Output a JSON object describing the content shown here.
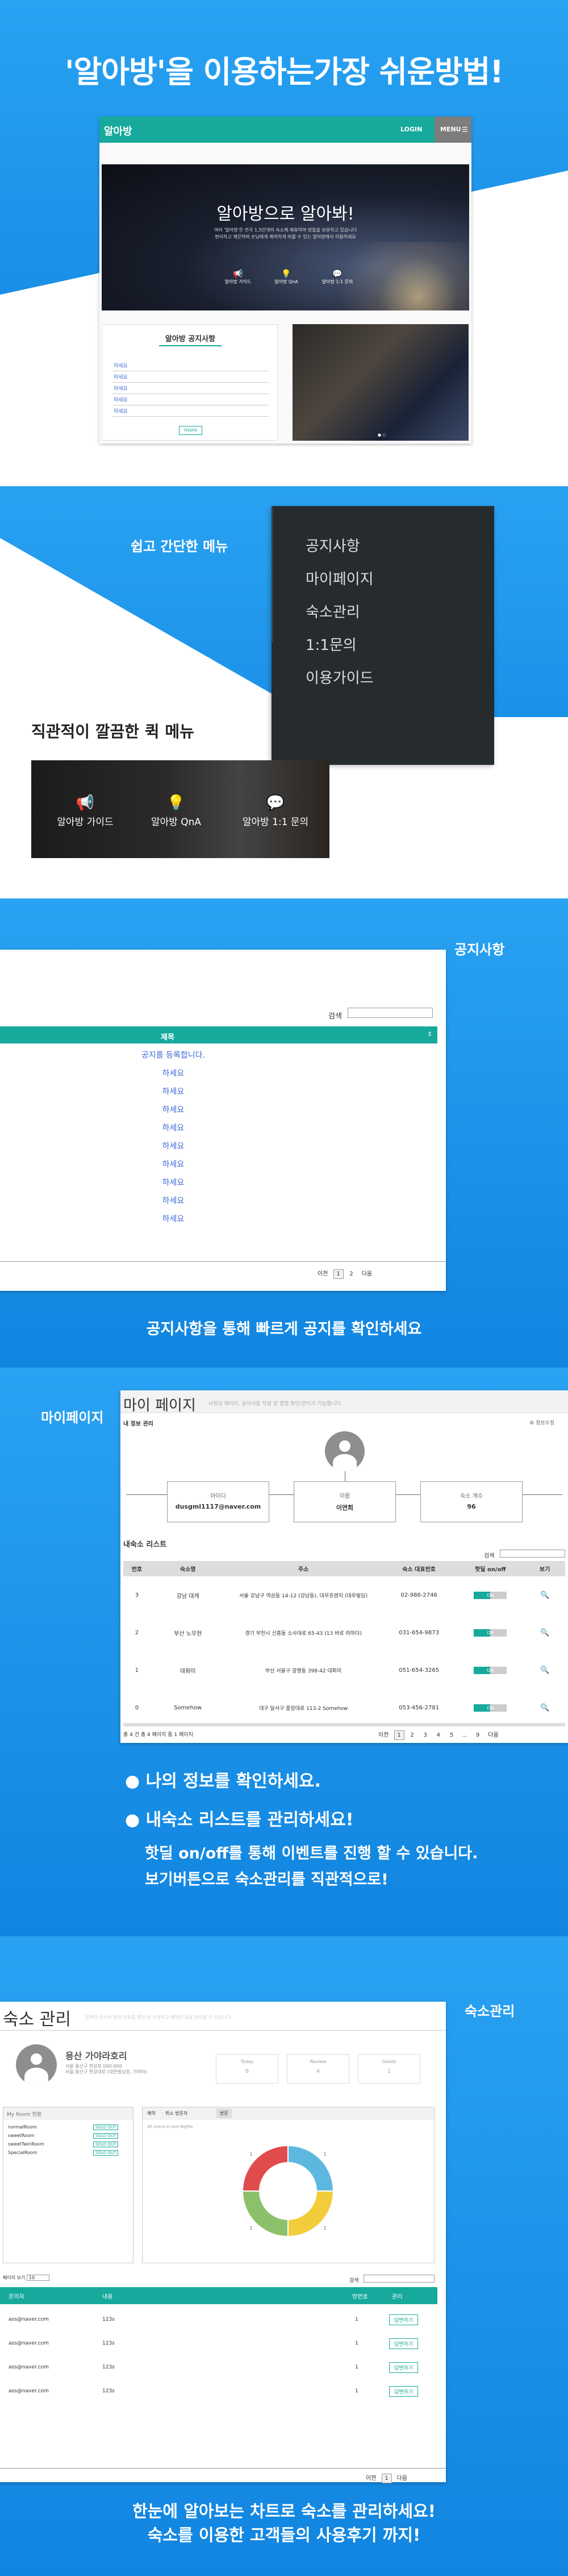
{
  "section1": {
    "headline": "'알아방'을 이용하는가장 쉬운방법!",
    "mock": {
      "logo": "알아방",
      "login": "LOGIN",
      "menu": "MENU",
      "hero_title": "알아방으로 알아봐!",
      "hero_sub1": "여러 '알아방'은 전국 1,5만개의 숙소에 제휴하여 방들을 보유하고 있습니다",
      "hero_sub2": "편리하고 깨끗하며 손님에게 쾌적하게 머물 수 있는 알아방에서 이용하세요",
      "quick": [
        "알아방 가이드",
        "알아방 QnA",
        "알아방 1:1 문의"
      ],
      "notice_title": "알아방 공지사항",
      "notice_items": [
        "하세요",
        "하세요",
        "하세요",
        "하세요",
        "하세요"
      ],
      "more": "more"
    }
  },
  "section2": {
    "menu_caption": "쉽고 간단한 메뉴",
    "menu_items": [
      "공지사항",
      "마이페이지",
      "숙소관리",
      "1:1문의",
      "이용가이드"
    ],
    "quick_caption": "직관적이 깔끔한 퀵 메뉴",
    "quick_items": [
      "알아방 가이드",
      "알아방 QnA",
      "알아방 1:1 문의"
    ]
  },
  "section3": {
    "label": "공지사항",
    "search_label": "검색",
    "col_title": "제목",
    "first_row": "공지를 등록합니다.",
    "rows": [
      "하세요",
      "하세요",
      "하세요",
      "하세요",
      "하세요",
      "하세요",
      "하세요",
      "하세요",
      "하세요"
    ],
    "prev": "이전",
    "pages": [
      "1",
      "2"
    ],
    "next": "다음",
    "caption": "공지사항을 통해 빠르게 공지를 확인하세요"
  },
  "section4": {
    "label": "마이페이지",
    "page_title": "마이 페이지",
    "page_sub": "사장님 페이지, 공지사항 작성 및 행정 확인/관리가 가능합니다.",
    "info_title": "내 정보 관리",
    "edit_label": "정보수정",
    "boxes": [
      {
        "label": "아이디",
        "value": "dusgml1117@naver.com"
      },
      {
        "label": "이름",
        "value": "이연희"
      },
      {
        "label": "숙소 개수",
        "value": "96"
      }
    ],
    "list_title": "내숙소 리스트",
    "search_label": "검색",
    "headers": [
      "번호",
      "숙소명",
      "주소",
      "숙소 대표번호",
      "핫딜 on/off",
      "보기"
    ],
    "rows": [
      {
        "no": "3",
        "name": "강남 대게",
        "addr": "서울 강남구 역삼동 14-12 (강남동), 대우프렌지 (대우빌딩)",
        "tel": "02-986-2746",
        "hot": "ON"
      },
      {
        "no": "2",
        "name": "부산 노무현",
        "addr": "경기 부천시 신흥동 소사대로 65-43 (13 바로 라마다)",
        "tel": "031-654-9873",
        "hot": "ON"
      },
      {
        "no": "1",
        "name": "대화미",
        "addr": "부산 서울구 광명동 398-42 대화미",
        "tel": "051-654-3265",
        "hot": "ON"
      },
      {
        "no": "0",
        "name": "Somehow",
        "addr": "대구 달서구 중앙대로 113-2 Somehow",
        "tel": "053-456-2781",
        "hot": "ON"
      }
    ],
    "total": "총 4 건 총 4 페이지 중 1 페이지",
    "prev": "이전",
    "pages": [
      "1",
      "2",
      "3",
      "4",
      "5",
      "...",
      "9"
    ],
    "next": "다음",
    "bullet1": "나의 정보를 확인하세요.",
    "bullet2": "내숙소 리스트를 관리하세요!",
    "sub1": "핫딜 on/off를 통해 이벤트를 진행 할 수 있습니다.",
    "sub2": "보기버튼으로 숙소관리를 직관적으로!"
  },
  "section5": {
    "label": "숙소관리",
    "page_title": "숙소 관리",
    "page_sub": "등록한 숙소와 방의 정보를 확인 및 수정하고 예약자 등을 관리할 수 있습니다.",
    "hotel_name": "용산 가야라호리",
    "hotel_line1": "서울 용산구 한강로 000-000",
    "hotel_line2": "서울 용산구 한강대로 (대한빌딩층, 가야라)",
    "stats": [
      {
        "label": "Today",
        "value": "0"
      },
      {
        "label": "Review",
        "value": "4"
      },
      {
        "label": "Goods",
        "value": "1"
      }
    ],
    "room_title": "My Room 현황",
    "rooms": [
      {
        "name": "normalRoom",
        "status": "SOLD OUT"
      },
      {
        "name": "sweetRoom",
        "status": "SOLD OUT"
      },
      {
        "name": "sweetTwinRoom",
        "status": "SOLD OUT"
      },
      {
        "name": "SpecialRoom",
        "status": "SOLD OUT"
      }
    ],
    "chart_tabs": [
      "예약",
      "취소 방문자",
      "방문"
    ],
    "chart_note": "All check-in and Nights",
    "chart_data": {
      "type": "pie",
      "categories": [
        "A",
        "B",
        "C",
        "D"
      ],
      "values": [
        25,
        25,
        25,
        25
      ],
      "colors": [
        "#5db8e0",
        "#f2cc3a",
        "#8bc16a",
        "#e04b4b"
      ],
      "labels": [
        "1",
        "1",
        "1",
        "1"
      ]
    },
    "rows_per_page": "페이지 보기",
    "rows_count": "10",
    "search_label": "검색",
    "headers": [
      "문의자",
      "내용",
      "방번호",
      "관리"
    ],
    "rows": [
      {
        "email": "ass@naver.com",
        "msg": "123s",
        "no": "1",
        "btn": "답변하기"
      },
      {
        "email": "ass@naver.com",
        "msg": "123s",
        "no": "1",
        "btn": "답변하기"
      },
      {
        "email": "ass@naver.com",
        "msg": "123s",
        "no": "1",
        "btn": "답변하기"
      },
      {
        "email": "ass@naver.com",
        "msg": "123s",
        "no": "1",
        "btn": "답변하기"
      }
    ],
    "prev": "이전",
    "pages": [
      "1"
    ],
    "next": "다음",
    "caption1": "한눈에 알아보는 차트로 숙소를 관리하세요!",
    "caption2": "숙소를 이용한 고객들의 사용후기 까지!"
  },
  "colors": {
    "brand": "#16a99c",
    "blue": "#1f8fe6"
  }
}
